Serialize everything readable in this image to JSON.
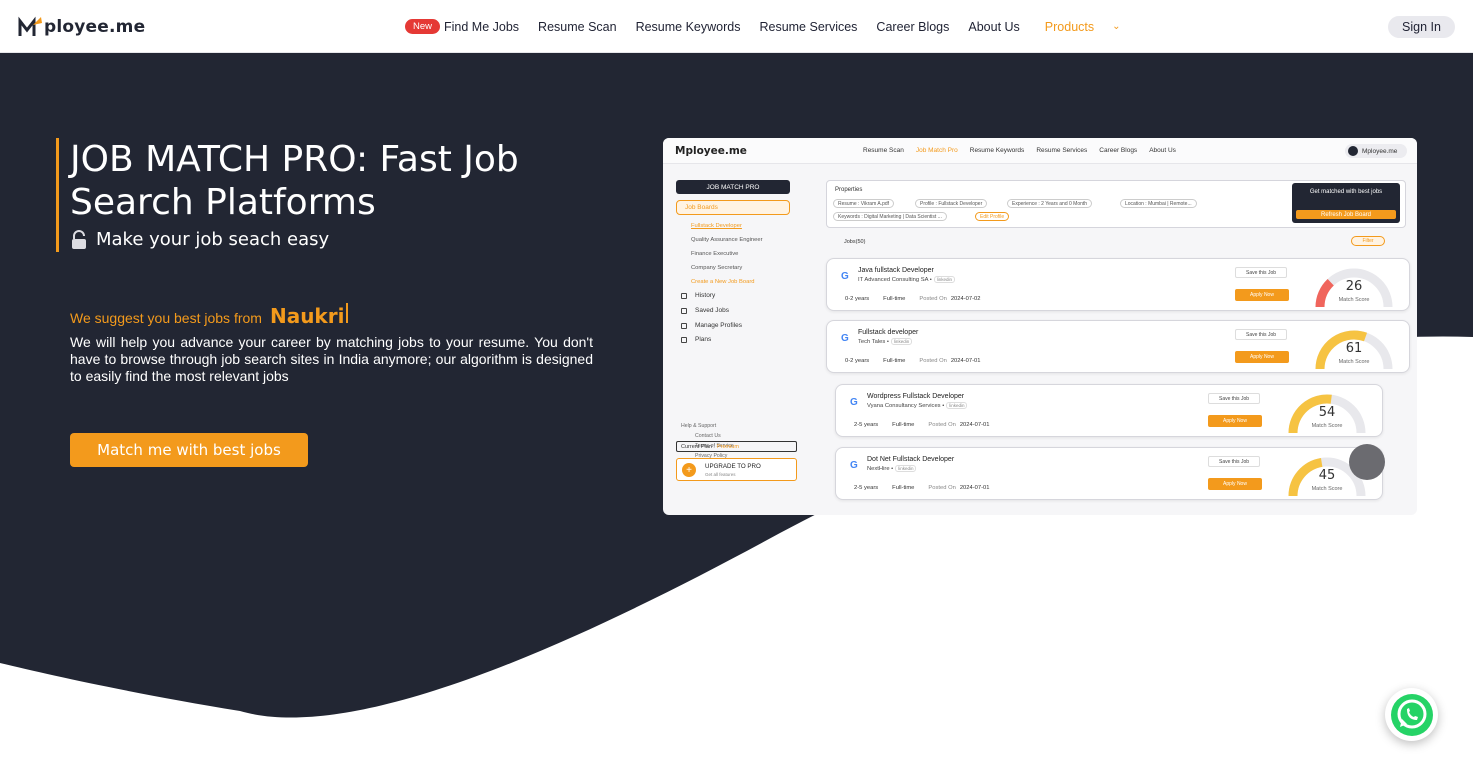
{
  "brand": {
    "logo_text": "ployee.me",
    "logo_m": "M"
  },
  "nav": {
    "new_badge": "New",
    "items": [
      "Find Me Jobs",
      "Resume Scan",
      "Resume Keywords",
      "Resume Services",
      "Career Blogs",
      "About Us"
    ],
    "products": "Products",
    "sign_in": "Sign In"
  },
  "hero": {
    "title": "JOB MATCH PRO: Fast Job Search Platforms",
    "subtitle": "Make your job seach easy",
    "suggest_prefix": "We suggest you best jobs from",
    "suggest_brand": "Naukri",
    "description": "We will help you advance your career by matching jobs to your resume. You don't have to browse through job search sites in India anymore; our algorithm is designed to easily find the most relevant jobs",
    "cta": "Match me with best jobs"
  },
  "preview": {
    "logo": "Mployee.me",
    "nav": [
      "Resume Scan",
      "Job Match Pro",
      "Resume Keywords",
      "Resume Services",
      "Career Blogs",
      "About Us"
    ],
    "user": "Mployee.me",
    "sidebar": {
      "header": "JOB MATCH PRO",
      "job_boards": "Job Boards",
      "sub_items": [
        "Fullstack Developer",
        "Quality Assurance Engineer",
        "Finance Executive",
        "Company Secretary",
        "Create a New Job Board"
      ],
      "main_items": [
        "History",
        "Saved Jobs",
        "Manage Profiles",
        "Plans"
      ],
      "help_title": "Help & Support",
      "help_items": [
        "Contact Us",
        "Terms of Service",
        "Privacy Policy"
      ],
      "plan_label": "Current Plan :",
      "plan_value": "Premium",
      "upgrade": "UPGRADE TO PRO",
      "upgrade_sub": "Get all features"
    },
    "properties": {
      "title": "Properties",
      "chips": [
        "Resume : Vikram A.pdf",
        "Profile : Fullstack Developer",
        "Experience : 2 Years and 0 Month",
        "Location : Mumbai | Remote...",
        "Keywords : Digital Marketing | Data Scientist ...",
        "Edit Profile"
      ],
      "get_matched": "Get matched with best jobs",
      "refresh": "Refresh Job Board"
    },
    "jobs_count": "Jobs(50)",
    "filter": "Filter",
    "save_label": "Save this Job",
    "apply_label": "Apply Now",
    "posted_label": "Posted On",
    "score_label": "Match Score",
    "jobs": [
      {
        "title": "Java fullstack Developer",
        "company": "IT Advanced Consulting SA",
        "source": "linkedin",
        "exp": "0-2 years",
        "type": "Full-time",
        "posted": "2024-07-02",
        "score": 26,
        "color": "#f0655c"
      },
      {
        "title": "Fullstack developer",
        "company": "Tech Tales",
        "source": "linkedin",
        "exp": "0-2 years",
        "type": "Full-time",
        "posted": "2024-07-01",
        "score": 61,
        "color": "#f6c342"
      },
      {
        "title": "Wordpress Fullstack Developer",
        "company": "Vyana Consultancy Services",
        "source": "linkedin",
        "exp": "2-5 years",
        "type": "Full-time",
        "posted": "2024-07-01",
        "score": 54,
        "color": "#f6c342"
      },
      {
        "title": "Dot Net Fullstack Developer",
        "company": "NextHire",
        "source": "linkedin",
        "exp": "2-5 years",
        "type": "Full-time",
        "posted": "2024-07-01",
        "score": 45,
        "color": "#f6c342"
      }
    ]
  },
  "colors": {
    "navy": "#222633",
    "accent": "#f39a1c",
    "whatsapp": "#25d366"
  }
}
